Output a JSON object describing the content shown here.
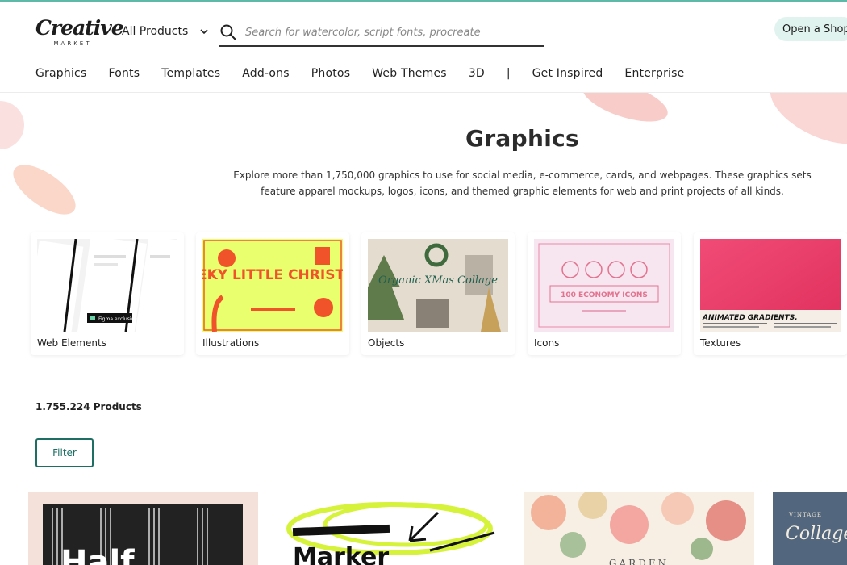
{
  "header": {
    "logo_text": "Creative",
    "logo_sub": "MARKET",
    "product_select": "All Products",
    "search_placeholder": "Search for watercolor, script fonts, procreate",
    "open_shop": "Open a Shop"
  },
  "nav": {
    "items": [
      "Graphics",
      "Fonts",
      "Templates",
      "Add-ons",
      "Photos",
      "Web Themes",
      "3D"
    ],
    "separator": "|",
    "items_after": [
      "Get Inspired",
      "Enterprise"
    ]
  },
  "hero": {
    "title": "Graphics",
    "description": "Explore more than 1,750,000 graphics to use for social media, e-commerce, cards, and webpages. These graphics sets feature apparel mockups, logos, icons, and themed graphic elements for web and print projects of all kinds."
  },
  "categories": [
    {
      "label": "Web Elements",
      "thumb_text": "Figma exclusive"
    },
    {
      "label": "Illustrations",
      "thumb_text": "CHEEKY LITTLE CHRISTMAS"
    },
    {
      "label": "Objects",
      "thumb_text": "Organic XMas Collage"
    },
    {
      "label": "Icons",
      "thumb_text": "100 ECONOMY ICONS"
    },
    {
      "label": "Textures",
      "thumb_text": "ANIMATED GRADIENTS."
    }
  ],
  "results": {
    "count": "1.755.224 Products",
    "filter_label": "Filter"
  },
  "products": [
    {
      "thumb_text": "Half"
    },
    {
      "thumb_text": "Marker"
    },
    {
      "thumb_text": "GARDEN"
    },
    {
      "thumb_text": "Collage Creator"
    }
  ],
  "colors": {
    "accent": "#1e6e64",
    "topline": "#5fb9a9",
    "open_shop_bg": "#e1f3ef"
  }
}
